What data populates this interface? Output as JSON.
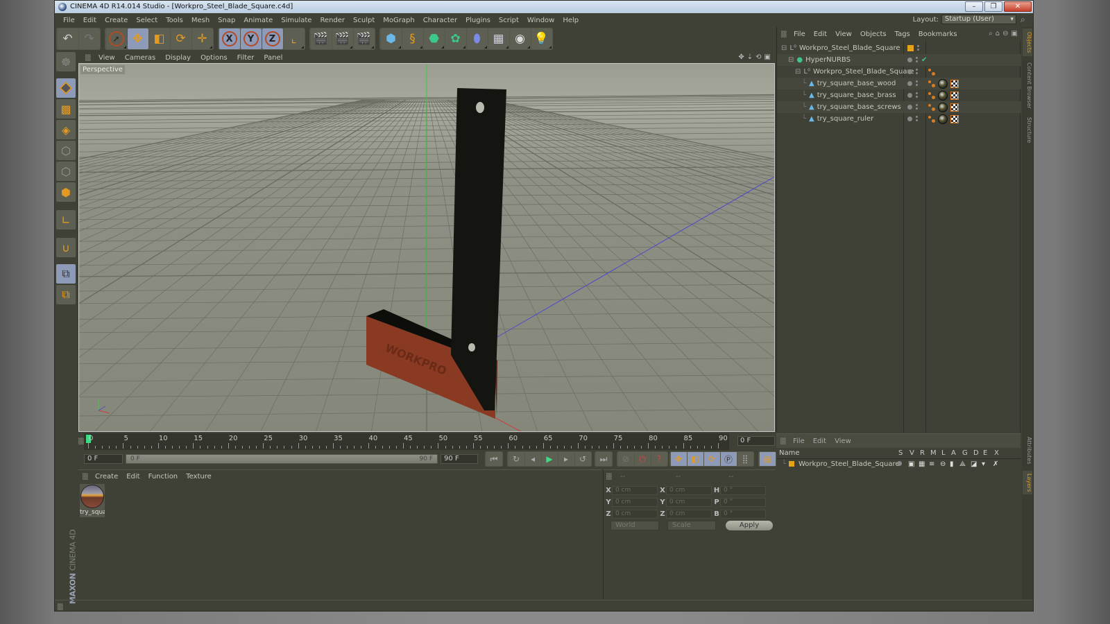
{
  "window": {
    "title": "CINEMA 4D R14.014 Studio - [Workpro_Steel_Blade_Square.c4d]",
    "buttons": [
      "minimize",
      "restore",
      "close"
    ]
  },
  "menubar": [
    "File",
    "Edit",
    "Create",
    "Select",
    "Tools",
    "Mesh",
    "Snap",
    "Animate",
    "Simulate",
    "Render",
    "Sculpt",
    "MoGraph",
    "Character",
    "Plugins",
    "Script",
    "Window",
    "Help"
  ],
  "layout": {
    "label": "Layout:",
    "value": "Startup (User)"
  },
  "toolbar": {
    "groups": [
      [
        "undo-icon",
        "redo-icon"
      ],
      [
        "live-selection-icon",
        "move-icon",
        "scale-icon",
        "rotate-icon",
        "recent-tool-icon"
      ],
      [
        "x-axis-lock-icon",
        "y-axis-lock-icon",
        "z-axis-lock-icon",
        "coordinate-system-icon"
      ],
      [
        "render-view-icon",
        "render-picture-viewer-icon",
        "render-settings-icon"
      ],
      [
        "cube-object-icon",
        "spline-pen-icon",
        "nurbs-icon",
        "array-icon",
        "deformer-icon",
        "floor-icon",
        "camera-icon",
        "light-icon"
      ]
    ],
    "active": [
      "move-icon",
      "x-axis-lock-icon",
      "y-axis-lock-icon",
      "z-axis-lock-icon"
    ],
    "axis_labels": [
      "X",
      "Y",
      "Z"
    ]
  },
  "left_toolbar": [
    "make-editable-icon",
    "model-mode-icon",
    "texture-mode-icon",
    "workplane-icon",
    "points-mode-icon",
    "edges-mode-icon",
    "polygons-mode-icon",
    "axis-mode-icon",
    "snap-magnet-icon",
    "locked-workplane-icon",
    "planar-workplane-icon"
  ],
  "viewport": {
    "menu": [
      "View",
      "Cameras",
      "Display",
      "Options",
      "Filter",
      "Panel"
    ],
    "label": "Perspective",
    "engraving": "WORKPRO"
  },
  "object_manager": {
    "menu": [
      "File",
      "Edit",
      "View",
      "Objects",
      "Tags",
      "Bookmarks"
    ],
    "objects": [
      {
        "name": "Workpro_Steel_Blade_Square",
        "type": "null",
        "indent": 0,
        "expand": "⊟",
        "layer_color": "#e5a418",
        "tags": []
      },
      {
        "name": "HyperNURBS",
        "type": "hypernurbs",
        "indent": 1,
        "expand": "⊟",
        "check": "✔",
        "tags": []
      },
      {
        "name": "Workpro_Steel_Blade_Square",
        "type": "null",
        "indent": 2,
        "expand": "⊟",
        "tags": [
          "phong"
        ]
      },
      {
        "name": "try_square_base_wood",
        "type": "polygon",
        "indent": 3,
        "tags": [
          "phong",
          "material",
          "texture"
        ]
      },
      {
        "name": "try_square_base_brass",
        "type": "polygon",
        "indent": 3,
        "tags": [
          "phong",
          "material",
          "texture"
        ]
      },
      {
        "name": "try_square_base_screws",
        "type": "polygon",
        "indent": 3,
        "tags": [
          "phong",
          "material",
          "texture"
        ]
      },
      {
        "name": "try_square_ruler",
        "type": "polygon",
        "indent": 3,
        "tags": [
          "phong",
          "material",
          "texture"
        ]
      }
    ]
  },
  "timeline": {
    "labels": [
      "0",
      "5",
      "10",
      "15",
      "20",
      "25",
      "30",
      "35",
      "40",
      "45",
      "50",
      "55",
      "60",
      "65",
      "70",
      "75",
      "80",
      "85",
      "90"
    ],
    "current_frame": "0 F",
    "start_field": "0 F",
    "range_start": "0 F",
    "range_end": "90 F",
    "end_field": "90 F",
    "playhead": 0,
    "max": 90
  },
  "transport": [
    "go-to-start-icon",
    "record-keyframe-icon",
    "prev-frame-icon",
    "play-icon",
    "next-frame-icon",
    "loop-icon",
    "go-to-end-icon"
  ],
  "key_tools": [
    "motion-path-icon",
    "autokey-icon",
    "help-key-icon",
    "key-position-icon",
    "key-scale-icon",
    "key-rotation-icon",
    "key-param-icon",
    "key-pla-icon",
    "timeline-icon"
  ],
  "material_manager": {
    "menu": [
      "Create",
      "Edit",
      "Function",
      "Texture"
    ],
    "materials": [
      {
        "name": "try_squa"
      }
    ]
  },
  "coordinates": {
    "headers": [
      "--",
      "--",
      "--"
    ],
    "rows": [
      {
        "l1": "X",
        "v1": "0 cm",
        "l2": "X",
        "v2": "0 cm",
        "l3": "H",
        "v3": "0 °"
      },
      {
        "l1": "Y",
        "v1": "0 cm",
        "l2": "Y",
        "v2": "0 cm",
        "l3": "P",
        "v3": "0 °"
      },
      {
        "l1": "Z",
        "v1": "0 cm",
        "l2": "Z",
        "v2": "0 cm",
        "l3": "B",
        "v3": "0 °"
      }
    ],
    "mode1": "World",
    "mode2": "Scale",
    "apply": "Apply"
  },
  "layer_manager": {
    "menu": [
      "File",
      "Edit",
      "View"
    ],
    "columns": [
      "Name",
      "S",
      "V",
      "R",
      "M",
      "L",
      "A",
      "G",
      "D",
      "E",
      "X"
    ],
    "layers": [
      {
        "name": "Workpro_Steel_Blade_Square",
        "color": "#e5a418"
      }
    ]
  },
  "side_tabs": [
    "Objects",
    "Content Browser",
    "Structure",
    "Attributes",
    "Layers"
  ],
  "branding": {
    "maxon": "MAXON",
    "product": "CINEMA 4D"
  }
}
